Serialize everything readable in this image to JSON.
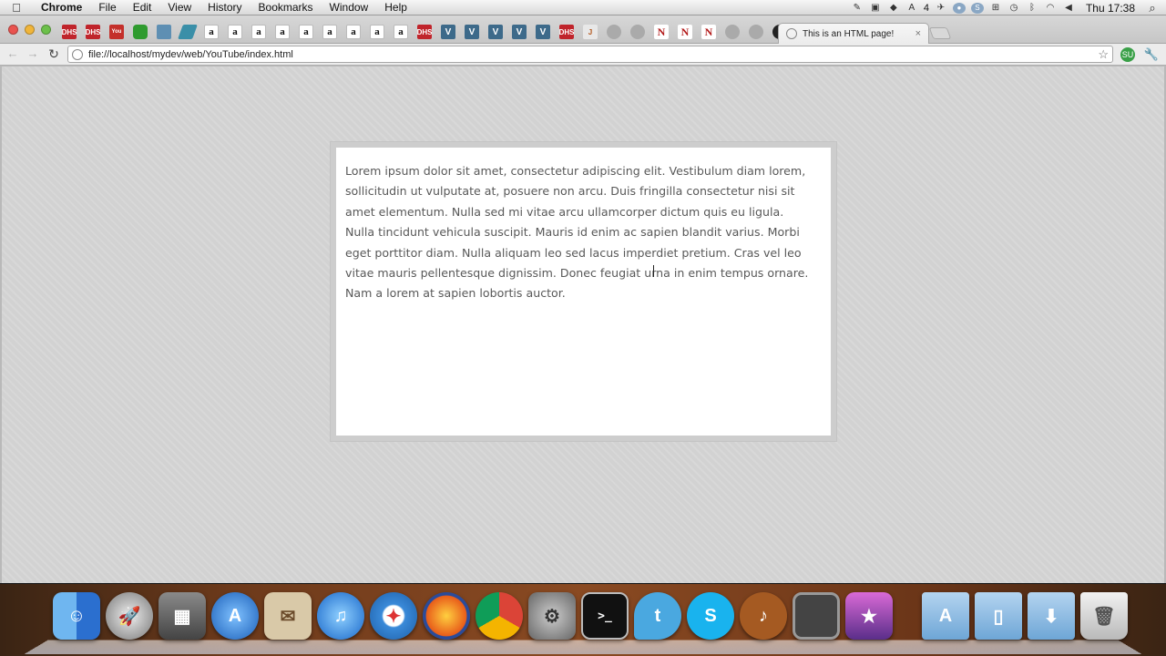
{
  "menubar": {
    "apple": "",
    "items": [
      "Chrome",
      "File",
      "Edit",
      "View",
      "History",
      "Bookmarks",
      "Window",
      "Help"
    ],
    "status_icons": [
      "evernote-icon",
      "screen-icon",
      "dropbox-icon",
      "adobe-icon",
      "twitter-icon",
      "chrome-icon",
      "skype-icon",
      "grid-icon",
      "time-machine-icon",
      "bluetooth-icon",
      "wifi-icon",
      "volume-icon"
    ],
    "adobe_count": "4",
    "clock": "Thu 17:38",
    "search_glyph": "⌕"
  },
  "tabstrip": {
    "pinned_tabs": [
      {
        "label": "DHS",
        "style": "red"
      },
      {
        "label": "DHS",
        "style": "red"
      },
      {
        "label": "You",
        "style": "yt"
      },
      {
        "label": "",
        "style": "green"
      },
      {
        "label": "",
        "style": "img"
      },
      {
        "label": "",
        "style": "teal"
      },
      {
        "label": "a",
        "style": "amz"
      },
      {
        "label": "a",
        "style": "amz"
      },
      {
        "label": "a",
        "style": "amz"
      },
      {
        "label": "a",
        "style": "amz"
      },
      {
        "label": "a",
        "style": "amz"
      },
      {
        "label": "a",
        "style": "amz"
      },
      {
        "label": "a",
        "style": "amz"
      },
      {
        "label": "a",
        "style": "amz"
      },
      {
        "label": "a",
        "style": "amz"
      },
      {
        "label": "DHS",
        "style": "red"
      },
      {
        "label": "V",
        "style": "v"
      },
      {
        "label": "V",
        "style": "v"
      },
      {
        "label": "V",
        "style": "v"
      },
      {
        "label": "V",
        "style": "v"
      },
      {
        "label": "V",
        "style": "v"
      },
      {
        "label": "DHS",
        "style": "red"
      },
      {
        "label": "J",
        "style": "java"
      },
      {
        "label": "",
        "style": "grey"
      },
      {
        "label": "",
        "style": "grey"
      },
      {
        "label": "N",
        "style": "n"
      },
      {
        "label": "N",
        "style": "n"
      },
      {
        "label": "N",
        "style": "n"
      },
      {
        "label": "",
        "style": "grey"
      },
      {
        "label": "",
        "style": "grey"
      },
      {
        "label": "",
        "style": "gh"
      }
    ],
    "active_tab_title": "This is an HTML page!",
    "active_tab_close": "×"
  },
  "toolbar": {
    "back": "←",
    "forward": "→",
    "reload": "↻",
    "url": "file://localhost/mydev/web/YouTube/index.html",
    "bookmark_star": "☆",
    "stumbleupon_label": "SU",
    "wrench": "🔧"
  },
  "page": {
    "paragraph": "Lorem ipsum dolor sit amet, consectetur adipiscing elit. Vestibulum diam lorem, sollicitudin ut vulputate at, posuere non arcu. Duis fringilla consectetur nisi sit amet elementum. Nulla sed mi vitae arcu ullamcorper dictum quis eu ligula. Nulla tincidunt vehicula suscipit. Mauris id enim ac sapien blandit varius. Morbi eget porttitor diam. Nulla aliquam leo sed lacus imperdiet pretium. Cras vel leo vitae mauris pellentesque dignissim. Donec feugiat urna in enim tempus ornare. Nam a lorem at sapien lobortis auctor."
  },
  "dock": {
    "apps": [
      {
        "name": "finder-icon",
        "glyph": "☺",
        "style": "d-finder"
      },
      {
        "name": "launchpad-icon",
        "glyph": "🚀",
        "style": "d-launchpad"
      },
      {
        "name": "photo-app-icon",
        "glyph": "▦",
        "style": "d-photos"
      },
      {
        "name": "app-store-icon",
        "glyph": "A",
        "style": "d-appstore"
      },
      {
        "name": "mail-icon",
        "glyph": "✉",
        "style": "d-mail"
      },
      {
        "name": "itunes-icon",
        "glyph": "♫",
        "style": "d-itunes"
      },
      {
        "name": "safari-icon",
        "glyph": "✦",
        "style": "d-safari"
      },
      {
        "name": "firefox-icon",
        "glyph": "",
        "style": "d-firefox"
      },
      {
        "name": "chrome-icon",
        "glyph": "",
        "style": "d-chrome"
      },
      {
        "name": "system-preferences-icon",
        "glyph": "⚙",
        "style": "d-settings"
      },
      {
        "name": "terminal-icon",
        "glyph": ">_",
        "style": "d-terminal"
      },
      {
        "name": "twitter-icon",
        "glyph": "t",
        "style": "d-twitter"
      },
      {
        "name": "skype-icon",
        "glyph": "S",
        "style": "d-skype"
      },
      {
        "name": "garageband-icon",
        "glyph": "♪",
        "style": "d-garageband"
      },
      {
        "name": "blank-app-icon",
        "glyph": "",
        "style": "d-blank"
      },
      {
        "name": "imovie-icon",
        "glyph": "★",
        "style": "d-imovie"
      }
    ],
    "stacks": [
      {
        "name": "applications-folder-icon",
        "glyph": "A",
        "style": "d-folder"
      },
      {
        "name": "documents-folder-icon",
        "glyph": "▯",
        "style": "d-folder"
      },
      {
        "name": "downloads-folder-icon",
        "glyph": "⬇",
        "style": "d-folder"
      },
      {
        "name": "trash-icon",
        "glyph": "🗑",
        "style": "d-trash"
      }
    ]
  }
}
